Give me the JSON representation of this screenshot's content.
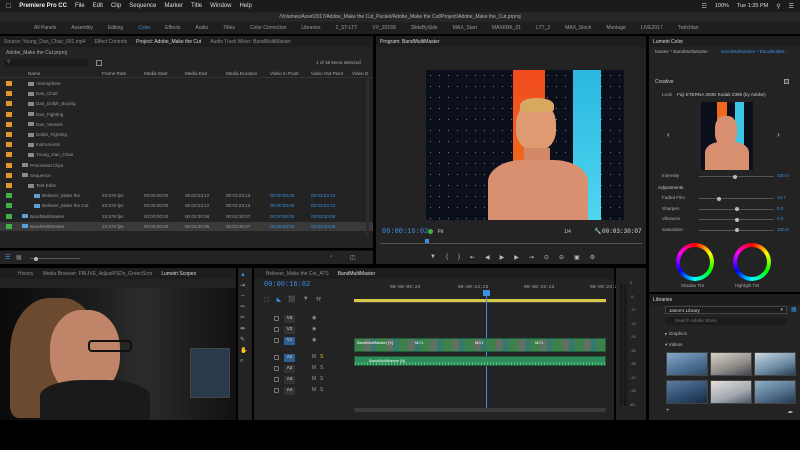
{
  "menubar": {
    "app": "Premiere Pro CC",
    "menus": [
      "File",
      "Edit",
      "Clip",
      "Sequence",
      "Marker",
      "Title",
      "Window",
      "Help"
    ],
    "path": "/Volumes/Asset2017/Adobe_Make the Cut_Packet/Adobe_Make the Cut/Project/Adobe_Make the_Cut.prproj",
    "battery": "100%",
    "clock": "Tue 1:35 PM"
  },
  "workspaces": [
    "All Panels",
    "Assembly",
    "Editing",
    "Color",
    "Effects",
    "Audio",
    "Titles",
    "Color Correction",
    "Libraries",
    "2_ST-LTT",
    "VV_20168",
    "SlideBySide",
    "MAX_Start",
    "MAXKBK_01",
    "LTT_2",
    "MAX_Stock",
    "Montage",
    "LIVE2017",
    "Twitchlan"
  ],
  "active_workspace": "Color",
  "project_panel": {
    "tabs": [
      "Source: Young_Dan_Chair_001.mp4",
      "Effect Controls",
      "Project: Adobe_Make the Cut",
      "Audio Track Mixer: BandMultiMaster"
    ],
    "project_name": "Adobe_Make the Cut.prproj",
    "items_selected": "1 of 18 items selected",
    "columns": [
      "Name",
      "Frame Rate",
      "Media Start",
      "Media End",
      "Media Duration",
      "Video In Point",
      "Video Out Point",
      "Video D"
    ],
    "rows": [
      {
        "name": "Atmosphere",
        "rate": "",
        "start": "",
        "end": "",
        "dur": "",
        "in": "",
        "out": "",
        "color": "#e0962a",
        "indent": 2
      },
      {
        "name": "Dan_Chair",
        "rate": "",
        "start": "",
        "end": "",
        "dur": "",
        "in": "",
        "out": "",
        "color": "#e0962a",
        "indent": 2
      },
      {
        "name": "Dan_Dolph_Boxing",
        "rate": "",
        "start": "",
        "end": "",
        "dur": "",
        "in": "",
        "out": "",
        "color": "#e0962a",
        "indent": 2
      },
      {
        "name": "Dan_Fighting",
        "rate": "",
        "start": "",
        "end": "",
        "dur": "",
        "in": "",
        "out": "",
        "color": "#e0962a",
        "indent": 2
      },
      {
        "name": "Dan_Vessels",
        "rate": "",
        "start": "",
        "end": "",
        "dur": "",
        "in": "",
        "out": "",
        "color": "#e0962a",
        "indent": 2
      },
      {
        "name": "Dolph_Fighting",
        "rate": "",
        "start": "",
        "end": "",
        "dur": "",
        "in": "",
        "out": "",
        "color": "#e0962a",
        "indent": 2
      },
      {
        "name": "Instruments",
        "rate": "",
        "start": "",
        "end": "",
        "dur": "",
        "in": "",
        "out": "",
        "color": "#e0962a",
        "indent": 2
      },
      {
        "name": "Young_Dan_Chair",
        "rate": "",
        "start": "",
        "end": "",
        "dur": "",
        "in": "",
        "out": "",
        "color": "#e0962a",
        "indent": 2
      },
      {
        "name": "Processed Clips",
        "rate": "",
        "start": "",
        "end": "",
        "dur": "",
        "in": "",
        "out": "",
        "color": "#e0962a",
        "indent": 1
      },
      {
        "name": "Sequence",
        "rate": "",
        "start": "",
        "end": "",
        "dur": "",
        "in": "",
        "out": "",
        "color": "#e0962a",
        "indent": 1
      },
      {
        "name": "Test Edits",
        "rate": "",
        "start": "",
        "end": "",
        "dur": "",
        "in": "",
        "out": "",
        "color": "#e0962a",
        "indent": 2
      },
      {
        "name": "Believer_Make the",
        "rate": "23.976 fps",
        "start": "00:00:00:00",
        "end": "00:03:23:12",
        "dur": "00:03:23:13",
        "in": "00:00:00:00",
        "out": "00:03:23:12",
        "color": "#3fb04a",
        "indent": 3
      },
      {
        "name": "Believer_Make the Cut",
        "rate": "23.976 fps",
        "start": "00:00:00:00",
        "end": "00:03:23:12",
        "dur": "00:03:23:13",
        "in": "00:00:00:00",
        "out": "00:03:23:12",
        "color": "#3fb04a",
        "indent": 3
      },
      {
        "name": "BandMultiMaster",
        "rate": "23.976 fps",
        "start": "00:00:00:00",
        "end": "00:03:30:06",
        "dur": "00:03:30:07",
        "in": "00:00:00:00",
        "out": "00:03:30:06",
        "color": "#3fb04a",
        "indent": 1
      },
      {
        "name": "BandMultiMaster",
        "rate": "23.976 fps",
        "start": "00:00:00:00",
        "end": "00:03:30:06",
        "dur": "00:03:30:07",
        "in": "00:00:00:00",
        "out": "00:03:30:06",
        "color": "#3fb04a",
        "indent": 1
      }
    ]
  },
  "program_monitor": {
    "title": "Program: BandMultiMaster",
    "timecode": "00:00:16:02",
    "fit": "Fit",
    "resolution": "1/4",
    "duration": "00:03:30:07"
  },
  "lumetri": {
    "title": "Lumetri Color",
    "source": "Master * BandMultiMaster",
    "active": "BandMultiMaster * BandMultiM...",
    "section": "Creative",
    "look_label": "Look",
    "look_value": "Fuji ETERNA 250D Kodak 2395 (by Adobe)",
    "intensity_label": "Intensity",
    "intensity_value": "100.0",
    "adjustments_label": "Adjustments",
    "sliders": [
      {
        "label": "Faded Film",
        "value": "14.7",
        "pos": 0.26
      },
      {
        "label": "Sharpen",
        "value": "0.0",
        "pos": 0.5
      },
      {
        "label": "Vibrance",
        "value": "0.0",
        "pos": 0.5
      },
      {
        "label": "Saturation",
        "value": "100.0",
        "pos": 0.5
      }
    ],
    "shadow_tint": "Shadow Tint",
    "highlight_tint": "Highlight Tint"
  },
  "bottom_left": {
    "tabs": [
      "History",
      "Media Browser: FBLIVE_AdjustPSDs_GreenScrn",
      "Lumetri Scopes"
    ]
  },
  "timeline": {
    "tabs": [
      "Believer_Make the Cut_ATS",
      "BandMultiMaster"
    ],
    "timecode": "00:00:16:02",
    "ruler": [
      "00:00:09:23",
      "00:00:14:23",
      "00:00:19:23",
      "00:00:24:23"
    ],
    "video_tracks": [
      "V3",
      "V2",
      "V1"
    ],
    "audio_tracks": [
      "A1",
      "A2",
      "A3",
      "A4"
    ],
    "clip_label": "BandMultiMaster [V]",
    "clip_tag": "MC1",
    "audio_clip": "BandMultiMaster [A]"
  },
  "meter": {
    "marks": [
      "0",
      "-6",
      "-12",
      "-18",
      "-24",
      "-30",
      "-36",
      "-42",
      "-48",
      "dB"
    ]
  },
  "libraries": {
    "title": "Libraries",
    "library": "Jason's Library",
    "search": "Search Adobe Stock",
    "sections": [
      "Graphics",
      "Videos"
    ]
  }
}
